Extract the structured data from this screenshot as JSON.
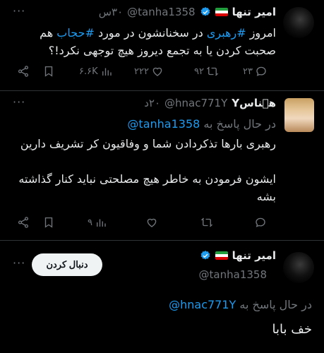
{
  "tweet1": {
    "name": "امیر تنها",
    "handle": "@tanha1358",
    "time": "۳۰س",
    "text_part1": "امروز ",
    "hashtag1": "#رهبری",
    "text_part2": " در سخنانشون در مورد ",
    "hashtag2": "#حجاب",
    "text_part3": " هم صحبت کردن یا به تجمع دیروز هیچ توجهی نکرد!؟",
    "replies": "۲۳",
    "retweets": "۹۲",
    "likes": "۲۲۲",
    "views": "۶.۶K"
  },
  "tweet2": {
    "name": "هٖناسY",
    "handle": "@hnac771Y",
    "time": "۲۰د",
    "reply_prefix": "در حال پاسخ به",
    "reply_to": "@tanha1358",
    "line1": "رهبری بارها تذکردادن شما و وفاقیون کر تشریف دارین",
    "line2": "ایشون فرمودن به خاطر هیچ مصلحتی نباید کنار گذاشته بشه",
    "views": "۹"
  },
  "tweet3": {
    "name": "امیر تنها",
    "handle": "@tanha1358",
    "follow_label": "دنبال کردن",
    "reply_prefix": "در حال پاسخ به",
    "reply_to": "@hnac771Y",
    "text": "خف بابا"
  },
  "colors": {
    "background": "#000000",
    "text": "#e7e9ea",
    "muted": "#71767b",
    "accent": "#1d9bf0",
    "divider": "#2f3336"
  },
  "icons": [
    "verified-badge-icon",
    "iran-flag-icon",
    "reply-icon",
    "retweet-icon",
    "like-icon",
    "views-icon",
    "bookmark-icon",
    "share-icon",
    "more-icon"
  ]
}
